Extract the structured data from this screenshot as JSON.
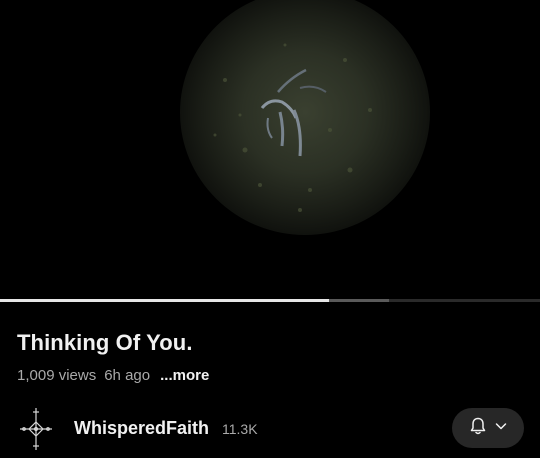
{
  "video": {
    "title": "Thinking Of You.",
    "views": "1,009 views",
    "age": "6h ago",
    "more_label": "...more",
    "progress": {
      "played_fraction": 0.61,
      "buffered_fraction": 0.72
    }
  },
  "channel": {
    "name": "WhisperedFaith",
    "subscribers": "11.3K",
    "avatar_icon": "cross-emblem-icon"
  },
  "actions": {
    "notify_icon": "bell-icon",
    "dropdown_icon": "chevron-down-icon"
  },
  "colors": {
    "background": "#000000",
    "primary_text": "#f1f1f1",
    "secondary_text": "#aaaaaa",
    "button_bg": "#272727",
    "progress_played": "#e6e6e6"
  }
}
